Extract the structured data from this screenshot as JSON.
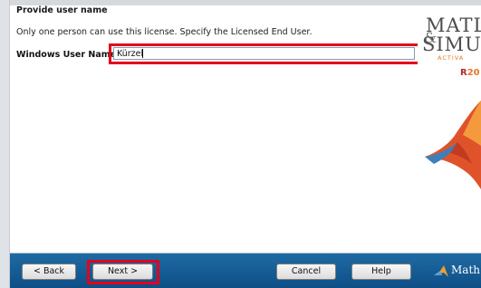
{
  "page": {
    "heading": "Provide user name",
    "description": "Only one person can use this license. Specify the Licensed End User.",
    "field_label": "Windows User Name:",
    "user_name_value": "Kürzel"
  },
  "branding": {
    "line1": "MATLA",
    "line2": "SIMU",
    "amp": "&",
    "activation": "ACTIVA",
    "release_r": "R",
    "release_rest": "20",
    "mathworks": "Math"
  },
  "buttons": {
    "back": "< Back",
    "next": "Next >",
    "cancel": "Cancel",
    "help": "Help"
  },
  "colors": {
    "footer": "#1f6aa3",
    "highlight": "#e3001b",
    "accent": "#e07a2f"
  }
}
